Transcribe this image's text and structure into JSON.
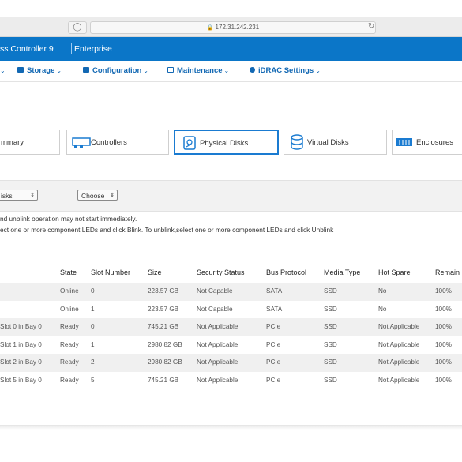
{
  "browser": {
    "url": "172.31.242.231"
  },
  "titlebar": {
    "product": "ss Controller 9",
    "edition": "Enterprise"
  },
  "nav": [
    {
      "label": "",
      "icon": "dashboard-icon"
    },
    {
      "label": "Storage",
      "icon": "storage-icon"
    },
    {
      "label": "Configuration",
      "icon": "configuration-icon"
    },
    {
      "label": "Maintenance",
      "icon": "maintenance-icon"
    },
    {
      "label": "iDRAC Settings",
      "icon": "settings-icon"
    }
  ],
  "cards": [
    {
      "label": "mmary",
      "icon": ""
    },
    {
      "label": "Controllers",
      "icon": "controller-icon"
    },
    {
      "label": "Physical Disks",
      "icon": "physical-disk-icon"
    },
    {
      "label": "Virtual Disks",
      "icon": "virtual-disk-icon"
    },
    {
      "label": "Enclosures",
      "icon": "enclosure-icon"
    }
  ],
  "filters": {
    "disks_select": "isks",
    "action_select": "Choose"
  },
  "notes": {
    "line1": "nd unblink operation may not start immediately.",
    "line2": "ect one or more component LEDs and click Blink. To unblink,select one or more component LEDs and click Unblink"
  },
  "table": {
    "headers": [
      "State",
      "Slot Number",
      "Size",
      "Security Status",
      "Bus Protocol",
      "Media Type",
      "Hot Spare",
      "Remain"
    ],
    "rows": [
      {
        "name": "",
        "state": "Online",
        "slot": "0",
        "size": "223.57 GB",
        "security": "Not Capable",
        "bus": "SATA",
        "media": "SSD",
        "spare": "No",
        "remain": "100%"
      },
      {
        "name": "",
        "state": "Online",
        "slot": "1",
        "size": "223.57 GB",
        "security": "Not Capable",
        "bus": "SATA",
        "media": "SSD",
        "spare": "No",
        "remain": "100%"
      },
      {
        "name": "Slot 0 in Bay 0",
        "state": "Ready",
        "slot": "0",
        "size": "745.21 GB",
        "security": "Not Applicable",
        "bus": "PCIe",
        "media": "SSD",
        "spare": "Not Applicable",
        "remain": "100%"
      },
      {
        "name": "Slot 1 in Bay 0",
        "state": "Ready",
        "slot": "1",
        "size": "2980.82 GB",
        "security": "Not Applicable",
        "bus": "PCIe",
        "media": "SSD",
        "spare": "Not Applicable",
        "remain": "100%"
      },
      {
        "name": "Slot 2 in Bay 0",
        "state": "Ready",
        "slot": "2",
        "size": "2980.82 GB",
        "security": "Not Applicable",
        "bus": "PCIe",
        "media": "SSD",
        "spare": "Not Applicable",
        "remain": "100%"
      },
      {
        "name": "Slot 5 in Bay 0",
        "state": "Ready",
        "slot": "5",
        "size": "745.21 GB",
        "security": "Not Applicable",
        "bus": "PCIe",
        "media": "SSD",
        "spare": "Not Applicable",
        "remain": "100%"
      }
    ]
  },
  "colors": {
    "brand_blue": "#0b76c8",
    "link_blue": "#1268b3",
    "active_border": "#1a7bd1"
  }
}
